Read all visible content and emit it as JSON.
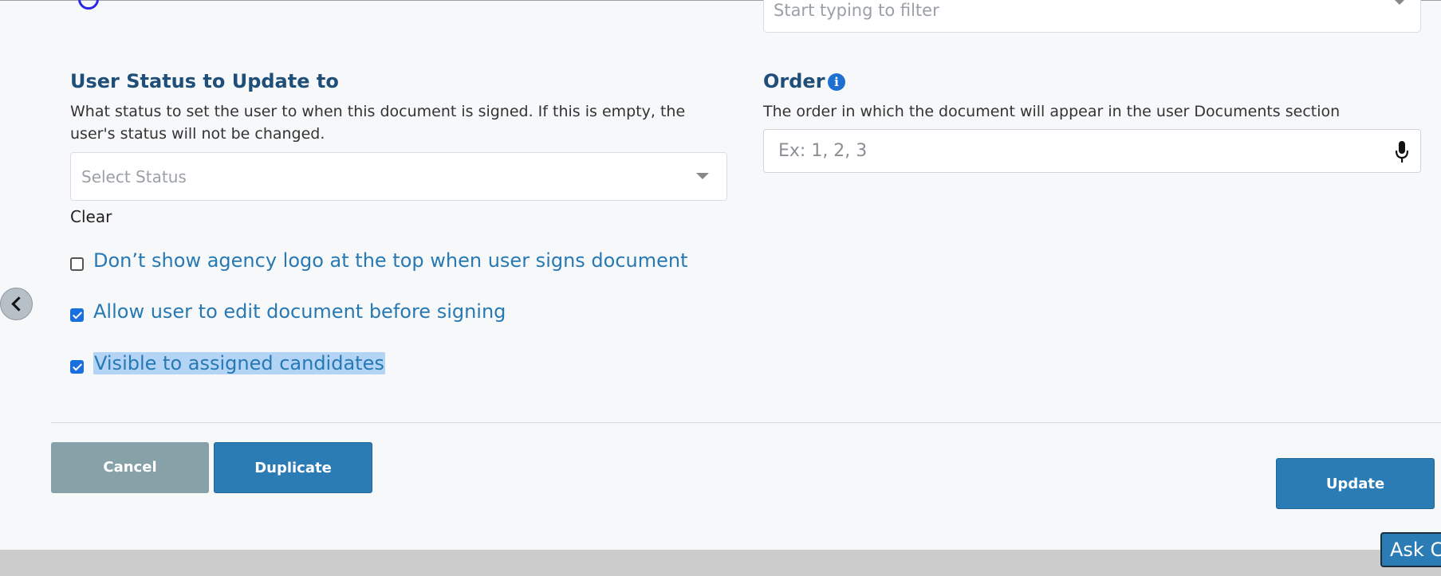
{
  "top_filter": {
    "placeholder": "Start typing to filter"
  },
  "user_status": {
    "title": "User Status to Update to",
    "description": "What status to set the user to when this document is signed. If this is empty, the user's status will not be changed.",
    "select_placeholder": "Select Status",
    "clear_label": "Clear"
  },
  "order": {
    "title": "Order",
    "info_glyph": "i",
    "description": "The order in which the document will appear in the user Documents section",
    "input_placeholder": "Ex: 1, 2, 3"
  },
  "options": [
    {
      "label": "Don’t show agency logo at the top when user signs document",
      "checked": false
    },
    {
      "label": "Allow user to edit document before signing",
      "checked": true
    },
    {
      "label": "Visible to assigned candidates",
      "checked": true
    }
  ],
  "buttons": {
    "cancel": "Cancel",
    "duplicate": "Duplicate",
    "update": "Update"
  },
  "chat": {
    "label": "Ask Ch"
  },
  "colors": {
    "primary_button": "#2b7bb5",
    "cancel_button": "#87a1a8",
    "label_text": "#2779b4",
    "heading_text": "#1f4e79",
    "checkbox": "#1a6fe0"
  },
  "icons": [
    "chevron-left-icon",
    "info-icon",
    "microphone-icon",
    "dropdown-caret-icon"
  ]
}
